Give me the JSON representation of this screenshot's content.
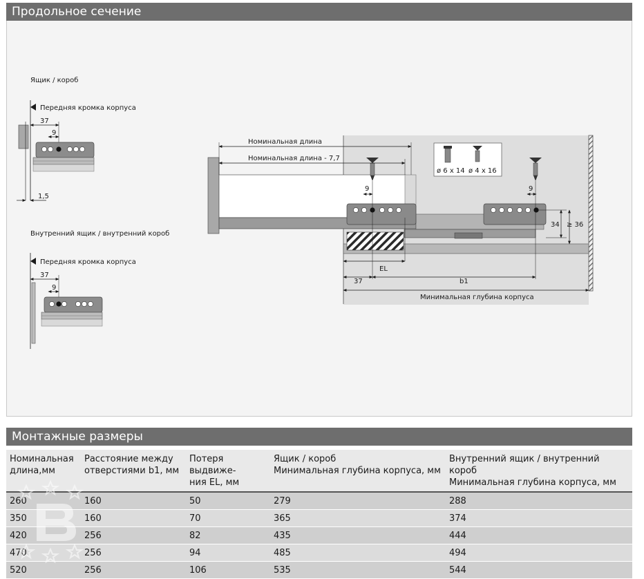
{
  "sections": {
    "longitudinal_title": "Продольное сечение",
    "mounting_title": "Монтажные размеры"
  },
  "diagram": {
    "box_label": "Ящик / короб",
    "inner_box_label": "Внутренний ящик / внутренний короб",
    "front_edge_label": "Передняя кромка корпуса",
    "front_edge_label_2": "Передняя кромка корпуса",
    "dim_37_a": "37",
    "dim_9_a": "9",
    "dim_1_5": "1,5",
    "dim_37_b": "37",
    "dim_9_b": "9",
    "nominal_length": "Номинальная длина",
    "nominal_length_minus": "Номинальная длина - 7,7",
    "screw_1": "ø 6 x 14",
    "screw_2": "ø 4 x 16",
    "dim_9_c": "9",
    "dim_9_d": "9",
    "dim_34": "34",
    "dim_ge36": "≥ 36",
    "dim_el": "EL",
    "dim_37_c": "37",
    "dim_b1": "b1",
    "min_depth": "Минимальная глубина корпуса"
  },
  "table": {
    "headers": [
      [
        "Номинальная",
        "длина,мм"
      ],
      [
        "Расстояние между",
        "отверстиями b1, мм"
      ],
      [
        "Потеря выдвиже-",
        "ния EL, мм"
      ],
      [
        "Ящик / короб",
        "Минимальная глубина корпуса, мм"
      ],
      [
        "Внутренний ящик / внутренний короб",
        "Минимальная глубина корпуса, мм"
      ]
    ],
    "rows": [
      [
        "260",
        "160",
        "50",
        "279",
        "288"
      ],
      [
        "350",
        "160",
        "70",
        "365",
        "374"
      ],
      [
        "420",
        "256",
        "82",
        "435",
        "444"
      ],
      [
        "470",
        "256",
        "94",
        "485",
        "494"
      ],
      [
        "520",
        "256",
        "106",
        "535",
        "544"
      ]
    ]
  },
  "colors": {
    "header_bar": "#6e6e6e",
    "panel_bg": "#f4f4f4",
    "rail": "#8c8c8c"
  }
}
